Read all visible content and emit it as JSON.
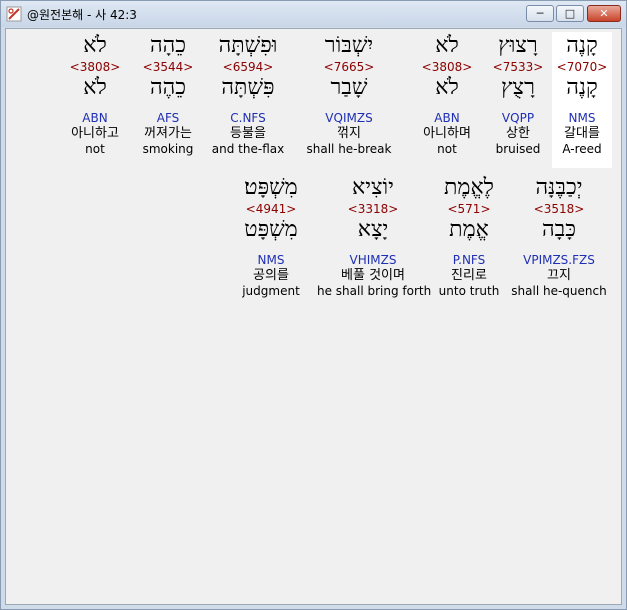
{
  "window": {
    "title": "@원전본해 - 사 42:3",
    "minimize_label": "─",
    "maximize_label": "□",
    "close_label": "✕"
  },
  "verse": {
    "line1": [
      {
        "heb": "קָנֶה",
        "strong": "<7070>",
        "heb2": "קָנֶה",
        "parse": "NMS",
        "kor": "갈대를",
        "eng": "A-reed"
      },
      {
        "heb": "רָצוּץ",
        "strong": "<7533>",
        "heb2": "רָצֻץ",
        "parse": "VQPP",
        "kor": "상한",
        "eng": "bruised"
      },
      {
        "heb": "לֹא",
        "strong": "<3808>",
        "heb2": "לֹא",
        "parse": "ABN",
        "kor": "아니하며",
        "eng": "not"
      },
      {
        "heb": "יִשְׁבּוֹר",
        "strong": "<7665>",
        "heb2": "שָׁבַר",
        "parse": "VQIMZS",
        "kor": "꺾지",
        "eng": "shall he-break"
      },
      {
        "heb": "וּפִשְׁתָּה",
        "strong": "<6594>",
        "heb2": "פִּשְׁתָּה",
        "parse": "C.NFS",
        "kor": "등불을",
        "eng": "and the-flax"
      },
      {
        "heb": "כֵהָה",
        "strong": "<3544>",
        "heb2": "כֵהֶה",
        "parse": "AFS",
        "kor": "꺼져가는",
        "eng": "smoking"
      },
      {
        "heb": "לֹא",
        "strong": "<3808>",
        "heb2": "לֹא",
        "parse": "ABN",
        "kor": "아니하고",
        "eng": "not"
      }
    ],
    "line2": [
      {
        "heb": "יְכַבֶּנָּה",
        "strong": "<3518>",
        "heb2": "כָּבָה",
        "parse": "VPIMZS.FZS",
        "kor": "끄지",
        "eng": "shall he-quench"
      },
      {
        "heb": "לֶאֱמֶת",
        "strong": "<571>",
        "heb2": "אֱמֶת",
        "parse": "P.NFS",
        "kor": "진리로",
        "eng": "unto truth"
      },
      {
        "heb": "יוֹצִיא",
        "strong": "<3318>",
        "heb2": "יָצָא",
        "parse": "VHIMZS",
        "kor": "베풀 것이며",
        "eng": "he shall bring forth"
      },
      {
        "heb": "מִשְׁפָּט׃",
        "strong": "<4941>",
        "heb2": "מִשְׁפָּט",
        "parse": "NMS",
        "kor": "공의를",
        "eng": "judgment"
      }
    ]
  }
}
